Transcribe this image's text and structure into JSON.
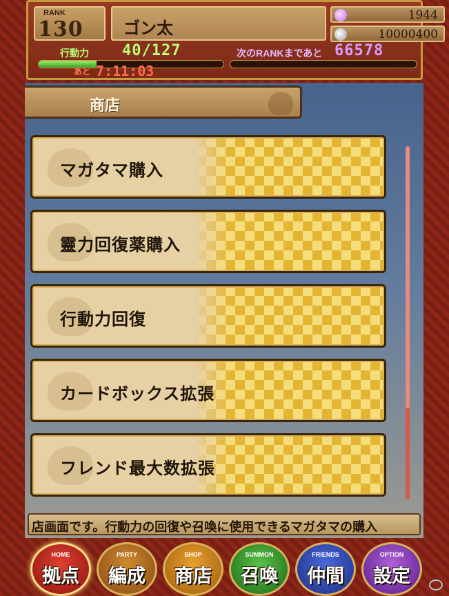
{
  "header": {
    "rank_label": "RANK",
    "rank_value": "130",
    "player_name": "ゴン太",
    "magatama_count": "1944",
    "coins": "10000400",
    "stamina_label": "行動力",
    "stamina_value": "40/127",
    "stamina_fraction": 0.315,
    "timer_prefix": "あと",
    "timer_value": "7:11:03",
    "next_rank_label": "次のRANKまであと",
    "next_rank_value": "66578",
    "exp_fraction": 0.0
  },
  "page": {
    "title": "商店"
  },
  "menu": {
    "items": [
      {
        "label": "マガタマ購入"
      },
      {
        "label": "靈力回復薬購入"
      },
      {
        "label": "行動力回復"
      },
      {
        "label": "カードボックス拡張"
      },
      {
        "label": "フレンド最大数拡張"
      }
    ]
  },
  "ticker": {
    "text": "店画面です。行動力の回復や召喚に使用できるマガタマの購入"
  },
  "nav": {
    "home": {
      "en": "HOME",
      "jp": "拠点"
    },
    "party": {
      "en": "PARTY",
      "jp": "編成"
    },
    "shop": {
      "en": "SHOP",
      "jp": "商店"
    },
    "summon": {
      "en": "SUMMON",
      "jp": "召喚"
    },
    "friends": {
      "en": "FRIENDS",
      "jp": "仲間"
    },
    "option": {
      "en": "OPTION",
      "jp": "設定"
    }
  },
  "icons": {
    "magatama": "magatama-icon",
    "coin": "coin-icon"
  },
  "colors": {
    "stamina_text": "#b7ff75",
    "timer_text": "#ff6a4a",
    "next_rank_text": "#d79cff",
    "gold_check": "#e3b532"
  }
}
